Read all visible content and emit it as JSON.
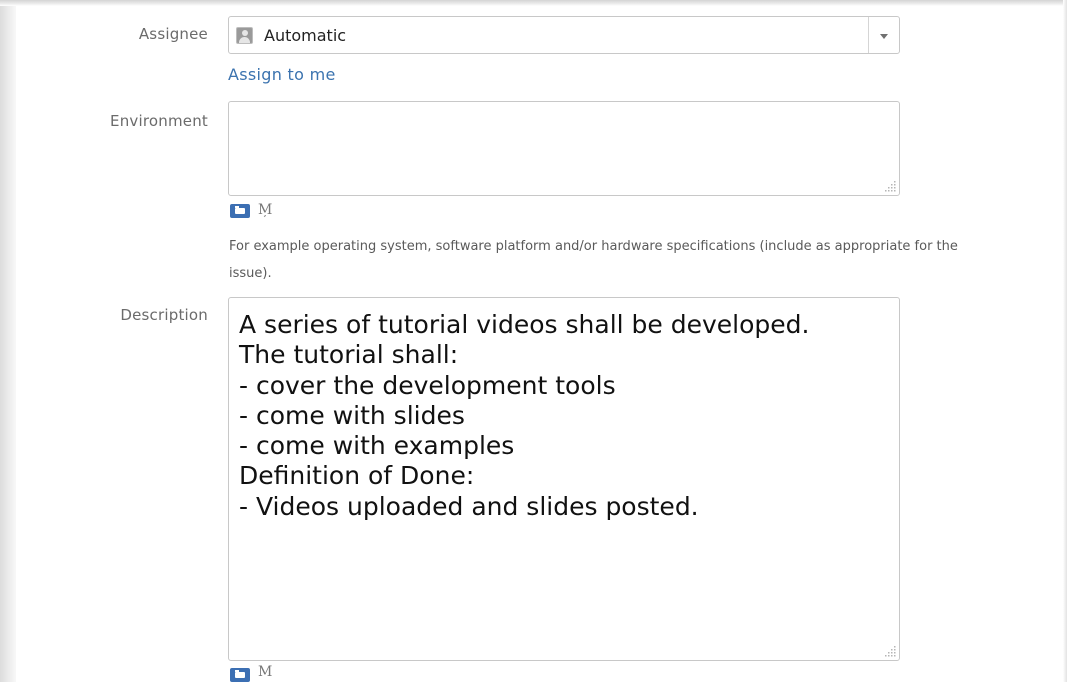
{
  "form": {
    "assignee": {
      "label": "Assignee",
      "selected_value": "Automatic",
      "avatar_icon": "user-avatar-icon",
      "dropdown_icon": "chevron-down-icon",
      "assign_to_me_link": "Assign to me"
    },
    "environment": {
      "label": "Environment",
      "value": "",
      "toolbar_icons": [
        "attachment-folder-icon",
        "markup-icon"
      ],
      "help_text": "For example operating system, software platform and/or hardware specifications (include as appropriate for the issue)."
    },
    "description": {
      "label": "Description",
      "value": "A series of tutorial videos shall be developed.\nThe tutorial shall:\n- cover the development tools\n- come with slides\n- come with examples\nDefinition of Done:\n- Videos uploaded and slides posted.",
      "toolbar_icons": [
        "attachment-folder-icon",
        "markup-icon"
      ]
    }
  },
  "colors": {
    "link": "#3b73af",
    "label": "#6b6b6b",
    "border": "#c8c8c8",
    "toolbar_icon": "#3c6fb3"
  }
}
